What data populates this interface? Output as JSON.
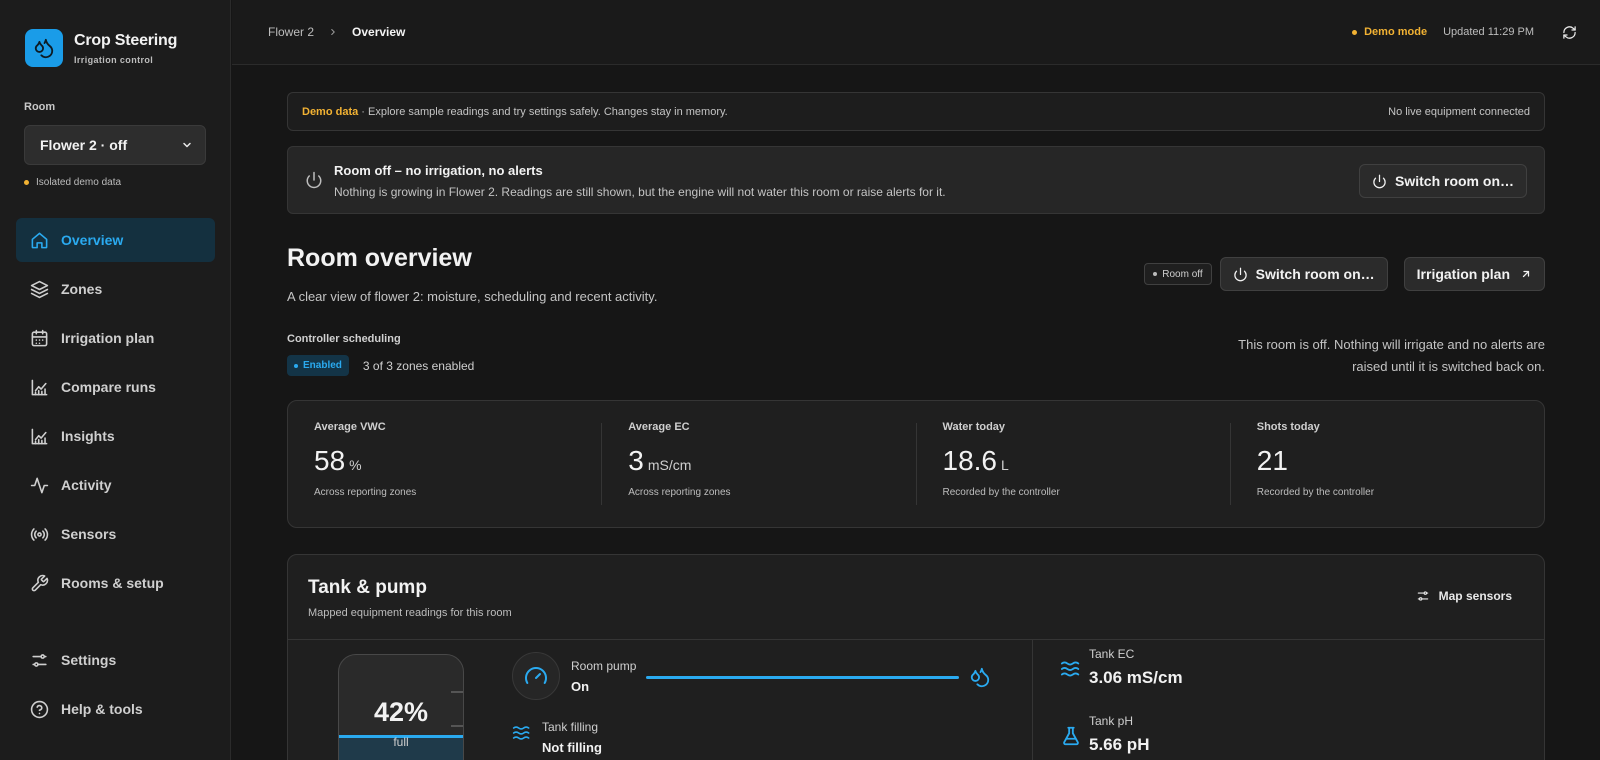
{
  "brand": {
    "title": "Crop Steering",
    "subtitle": "Irrigation control"
  },
  "room": {
    "label": "Room",
    "selected": "Flower 2 · off",
    "note": "Isolated demo data"
  },
  "nav": {
    "items": [
      {
        "label": "Overview",
        "icon": "home-icon",
        "active": true
      },
      {
        "label": "Zones",
        "icon": "layers-icon"
      },
      {
        "label": "Irrigation plan",
        "icon": "calendar-icon"
      },
      {
        "label": "Compare runs",
        "icon": "chart-icon"
      },
      {
        "label": "Insights",
        "icon": "chart-icon"
      },
      {
        "label": "Activity",
        "icon": "activity-icon"
      },
      {
        "label": "Sensors",
        "icon": "sensor-icon"
      },
      {
        "label": "Rooms & setup",
        "icon": "wrench-icon"
      }
    ],
    "bottom": [
      {
        "label": "Settings",
        "icon": "sliders-icon"
      },
      {
        "label": "Help & tools",
        "icon": "help-icon"
      }
    ]
  },
  "topbar": {
    "crumb_parent": "Flower 2",
    "crumb_current": "Overview",
    "demo_mode": "Demo mode",
    "updated": "Updated 11:29 PM"
  },
  "demo_banner": {
    "tag": "Demo data",
    "text": " · Explore sample readings and try settings safely. Changes stay in memory.",
    "right": "No live equipment connected"
  },
  "room_off": {
    "title": "Room off – no irrigation, no alerts",
    "text": "Nothing is growing in Flower 2. Readings are still shown, but the engine will not water this room or raise alerts for it.",
    "button": "Switch room on…"
  },
  "overview": {
    "title": "Room overview",
    "subtitle": "A clear view of flower 2: moisture, scheduling and recent activity.",
    "status_pill": "Room off",
    "switch_button": "Switch room on…",
    "plan_button": "Irrigation plan",
    "controller_label": "Controller scheduling",
    "enabled_badge": "Enabled",
    "zones_enabled": "3 of 3 zones enabled",
    "off_note": "This room is off. Nothing will irrigate and no alerts are raised until it is switched back on."
  },
  "stats": [
    {
      "label": "Average VWC",
      "value": "58",
      "unit": "%",
      "caption": "Across reporting zones"
    },
    {
      "label": "Average EC",
      "value": "3",
      "unit": "mS/cm",
      "caption": "Across reporting zones"
    },
    {
      "label": "Water today",
      "value": "18.6",
      "unit": "L",
      "caption": "Recorded by the controller"
    },
    {
      "label": "Shots today",
      "value": "21",
      "unit": "",
      "caption": "Recorded by the controller"
    }
  ],
  "tank": {
    "title": "Tank & pump",
    "subtitle": "Mapped equipment readings for this room",
    "map_button": "Map sensors",
    "level_pct": "42%",
    "level_fraction": 0.42,
    "level_word": "full",
    "pump_label": "Room pump",
    "pump_value": "On",
    "filling_label": "Tank filling",
    "filling_value": "Not filling",
    "ec_label": "Tank EC",
    "ec_value": "3.06 mS/cm",
    "ph_label": "Tank pH",
    "ph_value": "5.66 pH"
  },
  "colors": {
    "accent": "#2aaaf0",
    "warning": "#f2b233",
    "background": "#161616"
  }
}
